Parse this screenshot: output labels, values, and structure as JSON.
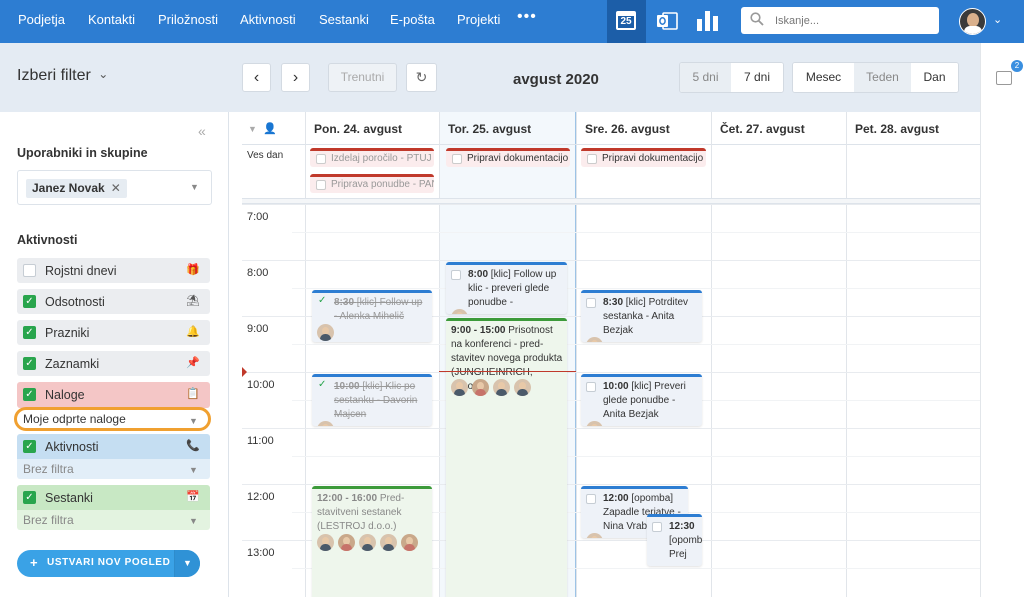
{
  "nav": {
    "items": [
      "Podjetja",
      "Kontakti",
      "Priložnosti",
      "Aktivnosti",
      "Sestanki",
      "E-pošta",
      "Projekti"
    ],
    "more": "•••",
    "calendar_day": "25",
    "search_placeholder": "Iskanje..."
  },
  "toolbar": {
    "filter_title": "Izberi filter",
    "prev": "‹",
    "next": "›",
    "current": "Trenutni",
    "refresh": "↻",
    "month_title": "avgust 2020",
    "days_5": "5 dni",
    "days_7": "7 dni",
    "view_month": "Mesec",
    "view_week": "Teden",
    "view_day": "Dan"
  },
  "rail": {
    "badge": "2"
  },
  "sidebar": {
    "collapse": "«",
    "users_heading": "Uporabniki in skupine",
    "user_tag": "Janez Novak",
    "user_tag_remove": "✕",
    "activities_heading": "Aktivnosti",
    "activities": [
      {
        "label": "Rojstni dnevi",
        "checked": false,
        "icon": "🎁"
      },
      {
        "label": "Odsotnosti",
        "checked": true,
        "icon": "⛱"
      },
      {
        "label": "Prazniki",
        "checked": true,
        "icon": "🔔"
      },
      {
        "label": "Zaznamki",
        "checked": true,
        "icon": "📌"
      },
      {
        "label": "Naloge",
        "checked": true,
        "icon": "📋",
        "color": "#f4c6c6",
        "sub": "Moje odprte naloge"
      },
      {
        "label": "Aktivnosti",
        "checked": true,
        "icon": "📞",
        "color": "#c5def2",
        "sub": "Brez filtra"
      },
      {
        "label": "Sestanki",
        "checked": true,
        "icon": "📅",
        "color": "#c8e8c4",
        "sub": "Brez filtra"
      }
    ],
    "create_button": "USTVARI NOV POGLED"
  },
  "calendar": {
    "days": [
      "Pon. 24. avgust",
      "Tor. 25. avgust",
      "Sre. 26. avgust",
      "Čet. 27. avgust",
      "Pet. 28. avgust"
    ],
    "allday_label": "Ves dan",
    "times": [
      "7:00",
      "8:00",
      "9:00",
      "10:00",
      "11:00",
      "12:00",
      "13:00"
    ],
    "allday_events": [
      {
        "text": "Izdelaj poročilo - PTUJ",
        "day": 0,
        "row": 0,
        "done": true
      },
      {
        "text": "Priprava ponudbe - PAN",
        "day": 0,
        "row": 1,
        "done": true
      },
      {
        "text": "Pripravi dokumentacijo",
        "day": 1,
        "row": 0,
        "done": false
      },
      {
        "text": "Pripravi dokumentacijo",
        "day": 2,
        "row": 0,
        "done": false
      }
    ],
    "events": {
      "mon_830": {
        "time": "8:30",
        "text": "[klic] Follow up - Alenka Mihelič"
      },
      "mon_1000": {
        "time": "10:00",
        "text": "[klic] Klic po sestanku - Davorin Majcen"
      },
      "mon_1200": {
        "time": "12:00 - 16:00",
        "text": "Pred-stavitveni sestanek (LESTROJ d.o.o.)"
      },
      "tue_800": {
        "time": "8:00",
        "text": "[klic] Follow up klic - preveri glede ponudbe -"
      },
      "tue_900": {
        "time": "9:00 - 15:00",
        "text": "Prisotnost na konferenci - pred-stavitev novega produkta (JUNGHEINRICH, d.o.o.)"
      },
      "wed_830": {
        "time": "8:30",
        "text": "[klic] Potrditev sestanka - Anita Bezjak"
      },
      "wed_1000": {
        "time": "10:00",
        "text": "[klic] Preveri glede ponudbe - Anita Bezjak"
      },
      "wed_1200": {
        "time": "12:00",
        "text": "[opomba] Zapadle terjatve - Nina Vrabič"
      },
      "wed_1230": {
        "time": "12:30",
        "text": "[opomba] Prej"
      }
    }
  }
}
